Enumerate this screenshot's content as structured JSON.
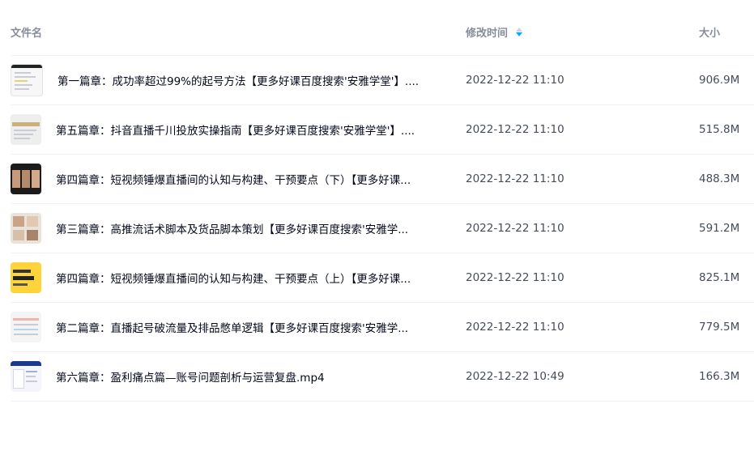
{
  "header": {
    "name_label": "文件名",
    "time_label": "修改时间",
    "size_label": "大小"
  },
  "files": [
    {
      "name": "第一篇章：成功率超过99%的起号方法【更多好课百度搜索'安雅学堂'】....",
      "time": "2022-12-22 11:10",
      "size": "906.9M",
      "thumb": "doc-white"
    },
    {
      "name": "第五篇章：抖音直播千川投放实操指南【更多好课百度搜索'安雅学堂'】....",
      "time": "2022-12-22 11:10",
      "size": "515.8M",
      "thumb": "doc-grey"
    },
    {
      "name": "第四篇章：短视频锤爆直播间的认知与构建、干预要点（下）【更多好课...",
      "time": "2022-12-22 11:10",
      "size": "488.3M",
      "thumb": "photo-strip"
    },
    {
      "name": "第三篇章：高推流话术脚本及货品脚本策划【更多好课百度搜索'安雅学...",
      "time": "2022-12-22 11:10",
      "size": "591.2M",
      "thumb": "photo-grid"
    },
    {
      "name": "第四篇章：短视频锤爆直播间的认知与构建、干预要点（上）【更多好课...",
      "time": "2022-12-22 11:10",
      "size": "825.1M",
      "thumb": "yellow-cover"
    },
    {
      "name": "第二篇章：直播起号破流量及排品憋单逻辑【更多好课百度搜索'安雅学...",
      "time": "2022-12-22 11:10",
      "size": "779.5M",
      "thumb": "doc-table"
    },
    {
      "name": "第六篇章：盈利痛点篇—账号问题剖析与运营复盘.mp4",
      "time": "2022-12-22 10:49",
      "size": "166.3M",
      "thumb": "slide-blue"
    }
  ],
  "colors": {
    "header_text": "#878c9c",
    "sort_active": "#06a7ff",
    "divider": "#f1f2f5"
  }
}
